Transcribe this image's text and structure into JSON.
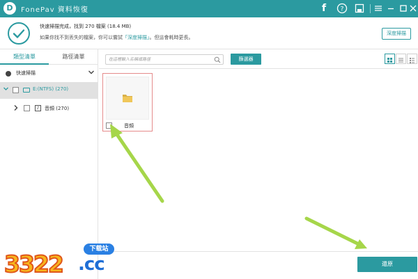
{
  "titlebar": {
    "app_name": "FonePav",
    "app_subtitle": "資料恢復",
    "icons": [
      "facebook-icon",
      "feedback-icon",
      "save-icon",
      "menu-icon",
      "minimize-icon",
      "maximize-icon",
      "close-icon"
    ]
  },
  "status": {
    "line1": "快速掃描完成，找到 270 檔案 (18.4 MB)",
    "line2_prefix": "如果你找不到丟失的檔案，你可以嘗試",
    "line2_link": "「深度掃描」",
    "line2_suffix": "。但這會耗時更長。",
    "deep_scan_label": "深度掃描"
  },
  "left_panel": {
    "tab_type": "類型清單",
    "tab_path": "路徑清單",
    "quick_scan": "快速掃描",
    "drive_label": "E:(NTFS) (270)",
    "folder_label": "音頻 (270)"
  },
  "toolbar": {
    "search_placeholder": "在這裡輸入名稱或路徑",
    "filter_label": "篩選器"
  },
  "content": {
    "items": [
      {
        "label": "音頻",
        "checked": false
      }
    ]
  },
  "footer": {
    "restore_label": "還原"
  },
  "watermark": {
    "badge": "下载站",
    "number": "3322",
    "suffix": ".cc"
  },
  "colors": {
    "accent": "#2b9aa0",
    "highlight_border": "#e58b8b",
    "arrow": "#a6d64a"
  }
}
